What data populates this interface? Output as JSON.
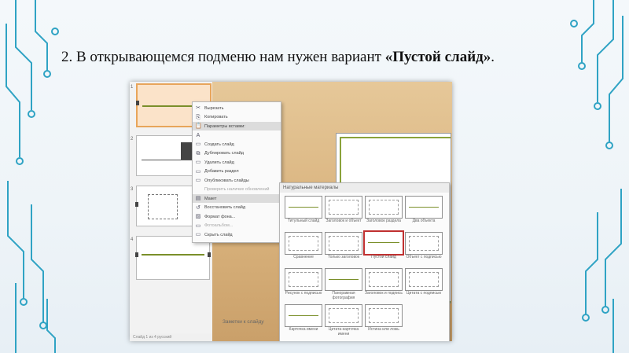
{
  "caption": {
    "prefix": "2. В открывающемся подменю нам нужен вариант ",
    "emphasis": "«Пустой слайд»",
    "suffix": "."
  },
  "thumbnails": [
    {
      "num": "1"
    },
    {
      "num": "2"
    },
    {
      "num": "3"
    },
    {
      "num": "4"
    }
  ],
  "context_menu": {
    "items": [
      {
        "label": "Вырезать",
        "icon": "cut-icon",
        "dim": false,
        "hl": false
      },
      {
        "label": "Копировать",
        "icon": "copy-icon",
        "dim": false,
        "hl": false
      },
      {
        "label": "Параметры вставки:",
        "icon": "paste-icon",
        "dim": false,
        "hl": true
      },
      {
        "label": "",
        "icon": "text-only-icon",
        "dim": false,
        "hl": false
      },
      {
        "label": "Создать слайд",
        "icon": "new-slide-icon",
        "dim": false,
        "hl": false
      },
      {
        "label": "Дублировать слайд",
        "icon": "duplicate-icon",
        "dim": false,
        "hl": false
      },
      {
        "label": "Удалить слайд",
        "icon": "delete-slide-icon",
        "dim": false,
        "hl": false
      },
      {
        "label": "Добавить раздел",
        "icon": "section-icon",
        "dim": false,
        "hl": false
      },
      {
        "label": "Опубликовать слайды",
        "icon": "publish-icon",
        "dim": false,
        "hl": false
      },
      {
        "label": "Проверить наличие обновлений",
        "icon": "",
        "dim": true,
        "hl": false
      },
      {
        "label": "Макет",
        "icon": "layout-icon",
        "dim": false,
        "hl": true
      },
      {
        "label": "Восстановить слайд",
        "icon": "reset-icon",
        "dim": false,
        "hl": false
      },
      {
        "label": "Формат фона...",
        "icon": "background-icon",
        "dim": false,
        "hl": false
      },
      {
        "label": "Фотоальбом...",
        "icon": "photo-album-icon",
        "dim": true,
        "hl": false
      },
      {
        "label": "Скрыть слайд",
        "icon": "hide-slide-icon",
        "dim": false,
        "hl": false
      }
    ]
  },
  "layout_submenu": {
    "header": "Натуральные материалы",
    "layouts": [
      {
        "label": "Титульный слайд"
      },
      {
        "label": "Заголовок и объект"
      },
      {
        "label": "Заголовок раздела"
      },
      {
        "label": "Два объекта"
      },
      {
        "label": "Сравнение"
      },
      {
        "label": "Только заголовок"
      },
      {
        "label": "Пустой слайд"
      },
      {
        "label": "Объект с подписью"
      },
      {
        "label": "Рисунок с подписью"
      },
      {
        "label": "Панорамная фотография"
      },
      {
        "label": "Заголовок и подпись"
      },
      {
        "label": "Цитата с подписью"
      },
      {
        "label": "Карточка имени"
      },
      {
        "label": "Цитата-карточка имени"
      },
      {
        "label": "Истина или ложь"
      }
    ]
  },
  "notes": "Заметки к слайду",
  "status": "Слайд 1 из 4 русский",
  "colors": {
    "accent": "#7a8f2a",
    "highlight": "#c03030",
    "selected_thumb": "#e8a55a"
  }
}
